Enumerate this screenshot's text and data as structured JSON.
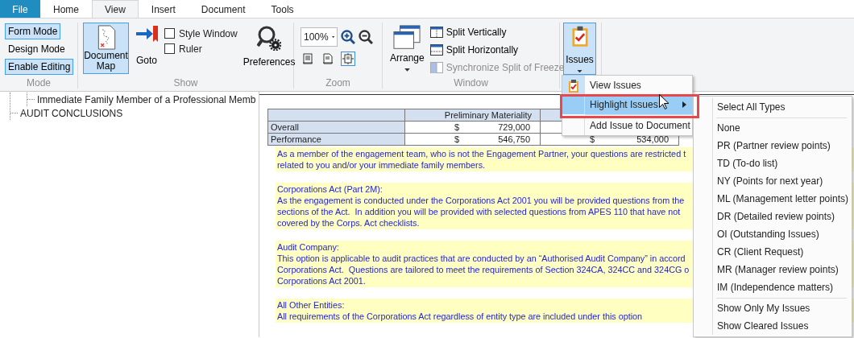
{
  "tabs": [
    {
      "label": "File",
      "kind": "file"
    },
    {
      "label": "Home",
      "kind": "tab",
      "selected": false
    },
    {
      "label": "View",
      "kind": "tab",
      "selected": true
    },
    {
      "label": "Insert",
      "kind": "tab",
      "selected": false
    },
    {
      "label": "Document",
      "kind": "tab",
      "selected": false
    },
    {
      "label": "Tools",
      "kind": "tab",
      "selected": false
    }
  ],
  "ribbon": {
    "mode": {
      "label": "Mode",
      "buttons": [
        {
          "label": "Form Mode",
          "selected": true
        },
        {
          "label": "Design Mode",
          "selected": false
        },
        {
          "label": "Enable Editing",
          "selected": true
        }
      ]
    },
    "show": {
      "label": "Show",
      "document_map": {
        "label": "Document Map",
        "selected": true
      },
      "goto": {
        "label": "Goto"
      },
      "checkboxes": [
        {
          "label": "Style Window",
          "checked": false
        },
        {
          "label": "Ruler",
          "checked": false
        }
      ],
      "preferences": {
        "label": "Preferences"
      }
    },
    "zoom": {
      "label": "Zoom",
      "zoom_select": {
        "value": "100%"
      },
      "fit_buttons": [
        {
          "kind": "fit-width",
          "selected": false
        },
        {
          "kind": "fit-page",
          "selected": false
        },
        {
          "kind": "fit-all",
          "selected": true
        }
      ]
    },
    "window": {
      "label": "Window",
      "arrange": {
        "label": "Arrange"
      },
      "commands": [
        {
          "kind": "split-vertical",
          "label": "Split Vertically",
          "disabled": false
        },
        {
          "kind": "split-horizontal",
          "label": "Split Horizontally",
          "disabled": false
        },
        {
          "kind": "sync",
          "label": "Synchronize Split of Freeze",
          "disabled": true
        }
      ]
    },
    "issues": {
      "label": "Issues",
      "pressed": true
    }
  },
  "document_map": {
    "items": [
      {
        "children": [
          {
            "label": "Immediate Family Member of a Professional Memb"
          }
        ]
      },
      {
        "label": "AUDIT CONCLUSIONS"
      }
    ]
  },
  "document": {
    "materiality_table": {
      "columns": [
        "Preliminary Materiality"
      ],
      "rows": [
        {
          "label": "Overall",
          "cells": [
            {
              "currency": "$",
              "amount": "729,000"
            }
          ]
        },
        {
          "label": "Performance",
          "cells": [
            {
              "currency": "$",
              "amount": "546,750"
            },
            {
              "currency": "$",
              "amount": "534,000"
            }
          ]
        }
      ]
    },
    "sections": [
      {
        "lines": [
          "As a member of the engagement team, who is not the Engagement Partner, your questions are restricted t",
          "related to you and/or your immediate family members."
        ]
      },
      {
        "heading": "Corporations Act (Part 2M):",
        "lines": [
          "As the engagement is conducted under the Corporations Act 2001 you will be provided questions from the",
          "sections of the Act.  In addition you will be provided with selected questions from APES 110 that have not",
          "covered by the Corps. Act checklists."
        ]
      },
      {
        "heading": "Audit Company:",
        "lines": [
          "This option is applicable to audit practices that are conducted by an “Authorised Audit Company” in accord",
          "Corporations Act.  Questions are tailored to meet the requirements of Section 324CA, 324CC and 324CG o",
          "Corporations Act 2001."
        ]
      },
      {
        "heading": "All Other Entities:",
        "lines": [
          "All requirements of the Corporations Act regardless of entity type are included under this option"
        ]
      }
    ]
  },
  "issues_menu": {
    "items": [
      {
        "kind": "icon",
        "label": "View Issues",
        "selected": false
      },
      {
        "kind": "submenu",
        "label": "Highlight Issues",
        "selected": true
      },
      {
        "kind": "separator"
      },
      {
        "kind": "command",
        "label": "Add Issue to Document",
        "selected": false
      }
    ]
  },
  "highlight_submenu": {
    "items": [
      {
        "kind": "item",
        "label": "Select All Types"
      },
      {
        "kind": "separator"
      },
      {
        "kind": "item",
        "label": "None"
      },
      {
        "kind": "item",
        "label": "PR (Partner review points)"
      },
      {
        "kind": "item",
        "label": "TD (To-do list)"
      },
      {
        "kind": "item",
        "label": "NY (Points for next year)"
      },
      {
        "kind": "item",
        "label": "ML (Management letter points)"
      },
      {
        "kind": "item",
        "label": "DR (Detailed review points)"
      },
      {
        "kind": "item",
        "label": "OI (Outstanding Issues)"
      },
      {
        "kind": "item",
        "label": "CR (Client Request)"
      },
      {
        "kind": "item",
        "label": "MR (Manager review points)"
      },
      {
        "kind": "item",
        "label": "IM (Independence matters)"
      },
      {
        "kind": "separator"
      },
      {
        "kind": "item",
        "label": "Show Only My Issues"
      },
      {
        "kind": "item",
        "label": "Show Cleared Issues"
      }
    ]
  }
}
